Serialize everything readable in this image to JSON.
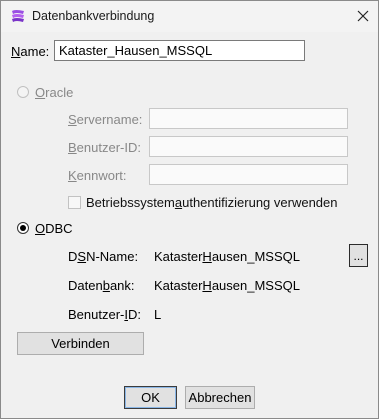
{
  "window": {
    "title": "Datenbankverbindung"
  },
  "name_field": {
    "label_first": "N",
    "label_rest": "ame:",
    "value": "Kataster_Hausen_MSSQL"
  },
  "oracle": {
    "label_first": "O",
    "label_u": "r",
    "label_rest": "acle",
    "servername": {
      "label_pre": "",
      "label_u": "S",
      "label_post": "ervername:",
      "value": ""
    },
    "user_id": {
      "label_pre": "",
      "label_u": "B",
      "label_post": "enutzer-ID:",
      "value": ""
    },
    "password": {
      "label_pre": "",
      "label_u": "K",
      "label_post": "ennwort:",
      "value": ""
    },
    "os_auth": {
      "label_pre": "Betriebssystem",
      "label_u": "a",
      "label_post": "uthentifizierung verwenden"
    }
  },
  "odbc": {
    "label_u": "O",
    "label_post": "DBC",
    "dsn": {
      "label_pre": "D",
      "label_u": "S",
      "label_post": "N-Name:",
      "value_pre": "Kataster",
      "value_u": "H",
      "value_post": "ausen_MSSQL",
      "browse_label": "..."
    },
    "database": {
      "label_pre": "Daten",
      "label_u": "b",
      "label_post": "ank:",
      "value_pre": "Kataster",
      "value_u": "H",
      "value_post": "ausen_MSSQL"
    },
    "user_id": {
      "label_pre": "Benutzer-",
      "label_u": "I",
      "label_post": "D:",
      "value": "L"
    }
  },
  "buttons": {
    "connect": "Verbinden",
    "ok": "OK",
    "cancel": "Abbrechen"
  },
  "colors": {
    "app_icon_top": "#8b3fd9",
    "app_icon_bottom": "#c26cf0",
    "radio_dot": "#000000"
  }
}
